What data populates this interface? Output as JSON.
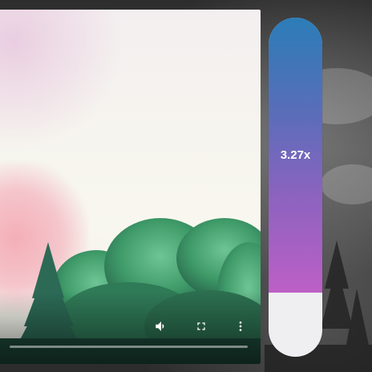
{
  "player": {
    "controls": {
      "volume_icon": "volume-icon",
      "fullscreen_icon": "fullscreen-icon",
      "more_icon": "more-vert-icon"
    },
    "progress_fraction": 0
  },
  "speed_slider": {
    "value_label": "3.27x",
    "fill_fraction": 0.81,
    "gradient_colors": [
      "#2b7db8",
      "#bd5fc6"
    ],
    "track_color": "#efeff1"
  }
}
